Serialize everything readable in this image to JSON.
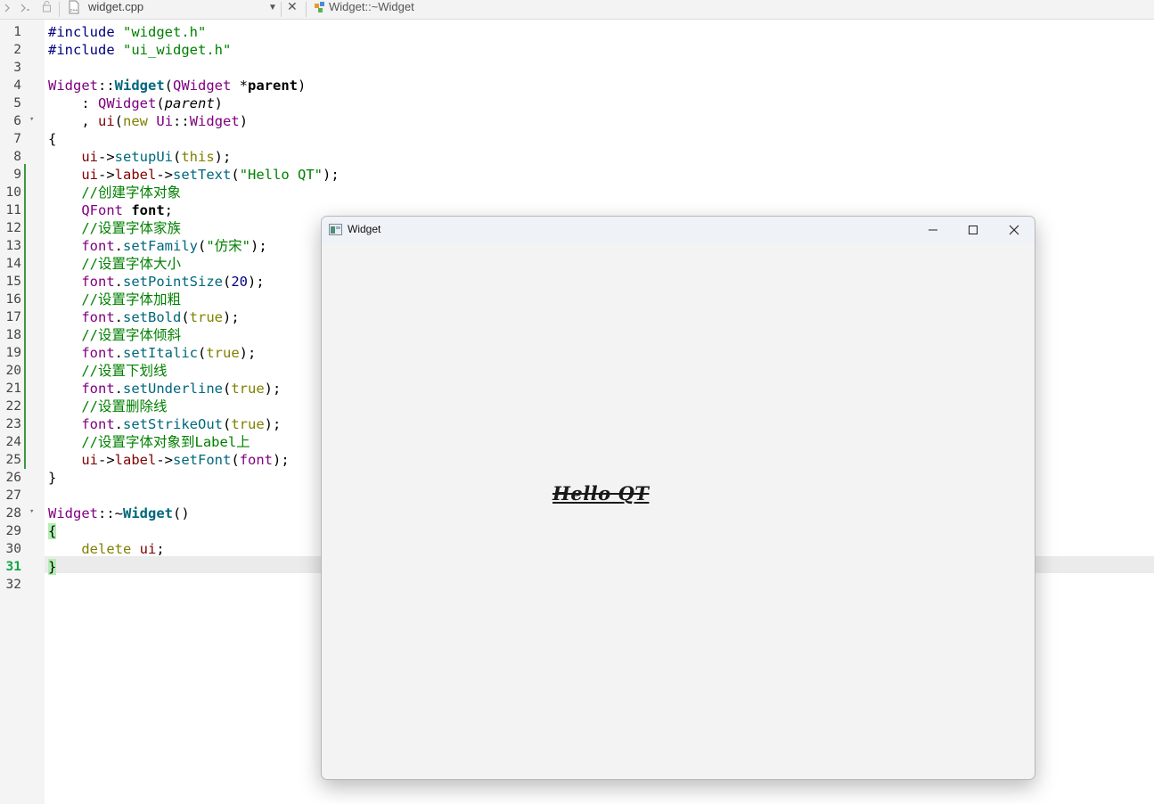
{
  "toolbar": {
    "file_name": "widget.cpp",
    "function_name": "Widget::~Widget",
    "icons": [
      "back-arrow-icon",
      "forward-arrow-icon",
      "lock-icon",
      "cpp-file-icon",
      "dropdown-icon",
      "close-icon",
      "class-function-icon"
    ]
  },
  "editor": {
    "current_line": 31,
    "lines": [
      [
        {
          "t": "#include ",
          "c": "pp"
        },
        {
          "t": "\"widget.h\"",
          "c": "str"
        }
      ],
      [
        {
          "t": "#include ",
          "c": "pp"
        },
        {
          "t": "\"ui_widget.h\"",
          "c": "str"
        }
      ],
      [],
      [
        {
          "t": "Widget",
          "c": "ty"
        },
        {
          "t": "::"
        },
        {
          "t": "Widget",
          "c": "fnb"
        },
        {
          "t": "("
        },
        {
          "t": "QWidget",
          "c": "ty"
        },
        {
          "t": " *"
        },
        {
          "t": "parent",
          "c": "par"
        },
        {
          "t": ")"
        }
      ],
      [
        {
          "t": "    : "
        },
        {
          "t": "QWidget",
          "c": "ty"
        },
        {
          "t": "("
        },
        {
          "t": "parent",
          "c": "it"
        },
        {
          "t": ")"
        }
      ],
      [
        {
          "t": "    , "
        },
        {
          "t": "ui",
          "c": "mem"
        },
        {
          "t": "("
        },
        {
          "t": "new",
          "c": "kw"
        },
        {
          "t": " "
        },
        {
          "t": "Ui",
          "c": "ty"
        },
        {
          "t": "::"
        },
        {
          "t": "Widget",
          "c": "ty"
        },
        {
          "t": ")"
        }
      ],
      [
        {
          "t": "{"
        }
      ],
      [
        {
          "t": "    "
        },
        {
          "t": "ui",
          "c": "mem"
        },
        {
          "t": "->"
        },
        {
          "t": "setupUi",
          "c": "fn"
        },
        {
          "t": "("
        },
        {
          "t": "this",
          "c": "kw"
        },
        {
          "t": ");"
        }
      ],
      [
        {
          "t": "    "
        },
        {
          "t": "ui",
          "c": "mem"
        },
        {
          "t": "->"
        },
        {
          "t": "label",
          "c": "mem"
        },
        {
          "t": "->"
        },
        {
          "t": "setText",
          "c": "fn"
        },
        {
          "t": "("
        },
        {
          "t": "\"Hello QT\"",
          "c": "str"
        },
        {
          "t": ");"
        }
      ],
      [
        {
          "t": "    "
        },
        {
          "t": "//创建字体对象",
          "c": "cm"
        }
      ],
      [
        {
          "t": "    "
        },
        {
          "t": "QFont",
          "c": "ty"
        },
        {
          "t": " "
        },
        {
          "t": "font",
          "c": "par"
        },
        {
          "t": ";"
        }
      ],
      [
        {
          "t": "    "
        },
        {
          "t": "//设置字体家族",
          "c": "cm"
        }
      ],
      [
        {
          "t": "    "
        },
        {
          "t": "font",
          "c": "ty"
        },
        {
          "t": "."
        },
        {
          "t": "setFamily",
          "c": "fn"
        },
        {
          "t": "("
        },
        {
          "t": "\"仿宋\"",
          "c": "str"
        },
        {
          "t": ");"
        }
      ],
      [
        {
          "t": "    "
        },
        {
          "t": "//设置字体大小",
          "c": "cm"
        }
      ],
      [
        {
          "t": "    "
        },
        {
          "t": "font",
          "c": "ty"
        },
        {
          "t": "."
        },
        {
          "t": "setPointSize",
          "c": "fn"
        },
        {
          "t": "("
        },
        {
          "t": "20",
          "c": "num"
        },
        {
          "t": ");"
        }
      ],
      [
        {
          "t": "    "
        },
        {
          "t": "//设置字体加粗",
          "c": "cm"
        }
      ],
      [
        {
          "t": "    "
        },
        {
          "t": "font",
          "c": "ty"
        },
        {
          "t": "."
        },
        {
          "t": "setBold",
          "c": "fn"
        },
        {
          "t": "("
        },
        {
          "t": "true",
          "c": "kw"
        },
        {
          "t": ");"
        }
      ],
      [
        {
          "t": "    "
        },
        {
          "t": "//设置字体倾斜",
          "c": "cm"
        }
      ],
      [
        {
          "t": "    "
        },
        {
          "t": "font",
          "c": "ty"
        },
        {
          "t": "."
        },
        {
          "t": "setItalic",
          "c": "fn"
        },
        {
          "t": "("
        },
        {
          "t": "true",
          "c": "kw"
        },
        {
          "t": ");"
        }
      ],
      [
        {
          "t": "    "
        },
        {
          "t": "//设置下划线",
          "c": "cm"
        }
      ],
      [
        {
          "t": "    "
        },
        {
          "t": "font",
          "c": "ty"
        },
        {
          "t": "."
        },
        {
          "t": "setUnderline",
          "c": "fn"
        },
        {
          "t": "("
        },
        {
          "t": "true",
          "c": "kw"
        },
        {
          "t": ");"
        }
      ],
      [
        {
          "t": "    "
        },
        {
          "t": "//设置删除线",
          "c": "cm"
        }
      ],
      [
        {
          "t": "    "
        },
        {
          "t": "font",
          "c": "ty"
        },
        {
          "t": "."
        },
        {
          "t": "setStrikeOut",
          "c": "fn"
        },
        {
          "t": "("
        },
        {
          "t": "true",
          "c": "kw"
        },
        {
          "t": ");"
        }
      ],
      [
        {
          "t": "    "
        },
        {
          "t": "//设置字体对象到Label上",
          "c": "cm"
        }
      ],
      [
        {
          "t": "    "
        },
        {
          "t": "ui",
          "c": "mem"
        },
        {
          "t": "->"
        },
        {
          "t": "label",
          "c": "mem"
        },
        {
          "t": "->"
        },
        {
          "t": "setFont",
          "c": "fn"
        },
        {
          "t": "("
        },
        {
          "t": "font",
          "c": "ty"
        },
        {
          "t": ");"
        }
      ],
      [
        {
          "t": "}"
        }
      ],
      [],
      [
        {
          "t": "Widget",
          "c": "ty"
        },
        {
          "t": "::~"
        },
        {
          "t": "Widget",
          "c": "fnb"
        },
        {
          "t": "()"
        }
      ],
      [
        {
          "t": "{",
          "c": "brace-hl"
        }
      ],
      [
        {
          "t": "    "
        },
        {
          "t": "delete",
          "c": "kw"
        },
        {
          "t": " "
        },
        {
          "t": "ui",
          "c": "mem"
        },
        {
          "t": ";"
        }
      ],
      [
        {
          "t": "}",
          "c": "brace-hl"
        }
      ],
      []
    ],
    "fold_markers_at_lines": [
      6,
      28
    ]
  },
  "app_window": {
    "title": "Widget",
    "label_text": "Hello QT",
    "buttons": [
      "minimize-icon",
      "maximize-icon",
      "close-icon"
    ]
  },
  "colors": {
    "type": "#800080",
    "string": "#008000",
    "function": "#00677c",
    "keyword": "#808000",
    "member": "#800000",
    "preprocessor": "#000080",
    "change_bar": "#3a9a3a",
    "current_line_number": "#14a34a"
  }
}
